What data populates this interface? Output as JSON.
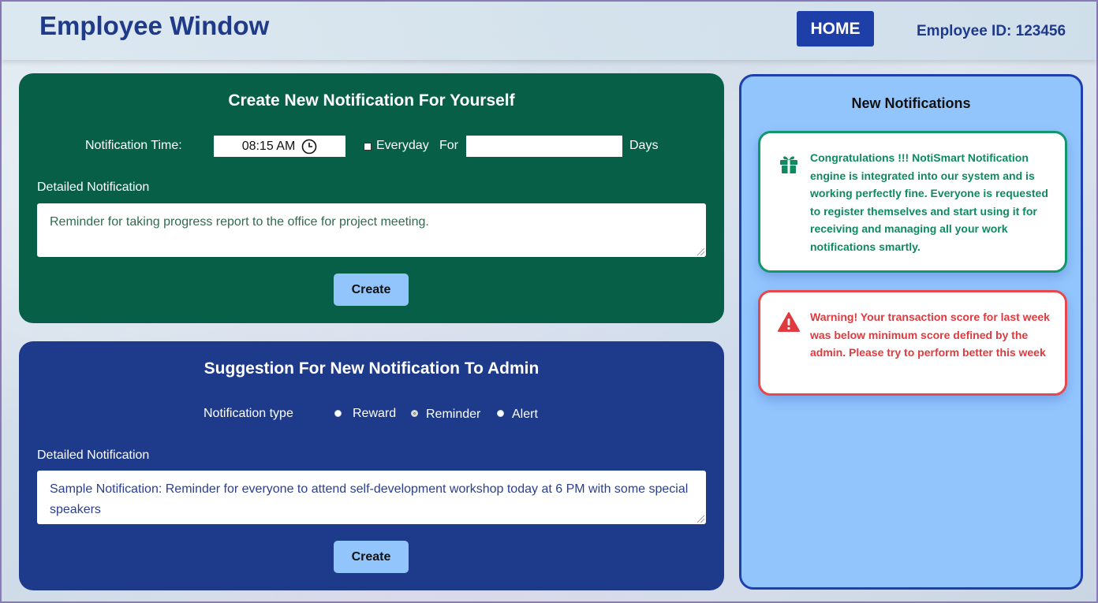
{
  "header": {
    "title": "Employee Window",
    "home_label": "HOME",
    "employee_id_label": "Employee ID: 123456"
  },
  "self_notification": {
    "title": "Create New Notification For Yourself",
    "time_label": "Notification Time:",
    "time_value": "08:15 AM",
    "everyday_label": "Everyday",
    "everyday_checked": false,
    "for_label": "For",
    "days_value": "",
    "days_label": "Days",
    "detail_label": "Detailed Notification",
    "detail_value": "Reminder for taking progress report to the office for project meeting.",
    "create_label": "Create"
  },
  "admin_suggestion": {
    "title": "Suggestion For New Notification To Admin",
    "type_label": "Notification type",
    "types": [
      "Reward",
      "Reminder",
      "Alert"
    ],
    "selected_type": "Reminder",
    "detail_label": "Detailed Notification",
    "detail_value": "Sample Notification: Reminder for everyone to attend self-development workshop today at 6 PM with some special speakers",
    "create_label": "Create"
  },
  "notifications": {
    "title": "New Notifications",
    "items": [
      {
        "kind": "reward",
        "icon": "gift-icon",
        "color": "#0f8a5f",
        "text": "Congratulations !!! NotiSmart Notification engine is integrated into our system and is working perfectly fine. Everyone is requested to register themselves and start using it for receiving and managing all your work notifications smartly."
      },
      {
        "kind": "alert",
        "icon": "warning-icon",
        "color": "#e03a3e",
        "text": "Warning! Your transaction score for last week was below minimum score defined by the admin. Please try to perform better this week"
      }
    ]
  },
  "colors": {
    "green_panel": "#065f46",
    "blue_panel": "#1e3a8a",
    "notif_panel": "#93c5fd",
    "accent_blue": "#1e40af"
  }
}
